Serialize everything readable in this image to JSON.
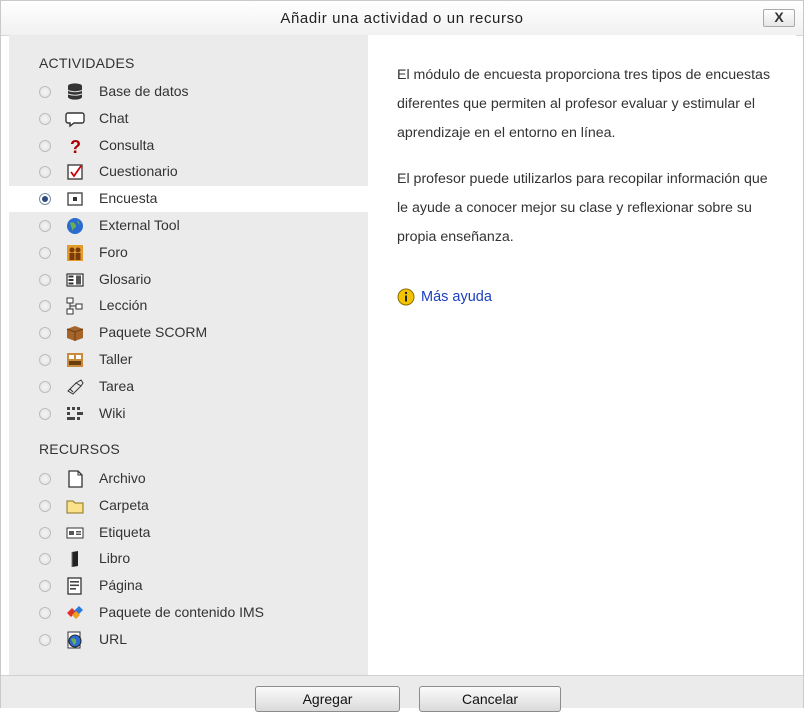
{
  "dialog": {
    "title": "Añadir una actividad o un recurso",
    "close_label": "X"
  },
  "activities": {
    "heading": "ACTIVIDADES",
    "items": [
      {
        "label": "Base de datos",
        "icon": "database-icon",
        "selected": false
      },
      {
        "label": "Chat",
        "icon": "chat-bubble-icon",
        "selected": false
      },
      {
        "label": "Consulta",
        "icon": "question-mark-icon",
        "selected": false
      },
      {
        "label": "Cuestionario",
        "icon": "checkbox-icon",
        "selected": false
      },
      {
        "label": "Encuesta",
        "icon": "survey-icon",
        "selected": true
      },
      {
        "label": "External Tool",
        "icon": "globe-icon",
        "selected": false
      },
      {
        "label": "Foro",
        "icon": "forum-people-icon",
        "selected": false
      },
      {
        "label": "Glosario",
        "icon": "glossary-book-icon",
        "selected": false
      },
      {
        "label": "Lección",
        "icon": "lesson-tree-icon",
        "selected": false
      },
      {
        "label": "Paquete SCORM",
        "icon": "package-box-icon",
        "selected": false
      },
      {
        "label": "Taller",
        "icon": "workshop-icon",
        "selected": false
      },
      {
        "label": "Tarea",
        "icon": "assignment-icon",
        "selected": false
      },
      {
        "label": "Wiki",
        "icon": "wiki-icon",
        "selected": false
      }
    ]
  },
  "resources": {
    "heading": "RECURSOS",
    "items": [
      {
        "label": "Archivo",
        "icon": "file-icon",
        "selected": false
      },
      {
        "label": "Carpeta",
        "icon": "folder-icon",
        "selected": false
      },
      {
        "label": "Etiqueta",
        "icon": "label-icon",
        "selected": false
      },
      {
        "label": "Libro",
        "icon": "book-icon",
        "selected": false
      },
      {
        "label": "Página",
        "icon": "page-icon",
        "selected": false
      },
      {
        "label": "Paquete de contenido IMS",
        "icon": "ims-package-icon",
        "selected": false
      },
      {
        "label": "URL",
        "icon": "url-globe-icon",
        "selected": false
      }
    ]
  },
  "description": {
    "paragraphs": [
      "El módulo de encuesta proporciona tres tipos de encuestas diferentes que permiten al profesor evaluar y estimular el aprendizaje en el entorno en línea.",
      "El profesor puede utilizarlos para recopilar información que le ayude a conocer mejor su clase y reflexionar sobre su propia enseñanza."
    ],
    "help_link": "Más ayuda"
  },
  "footer": {
    "add_label": "Agregar",
    "cancel_label": "Cancelar"
  }
}
